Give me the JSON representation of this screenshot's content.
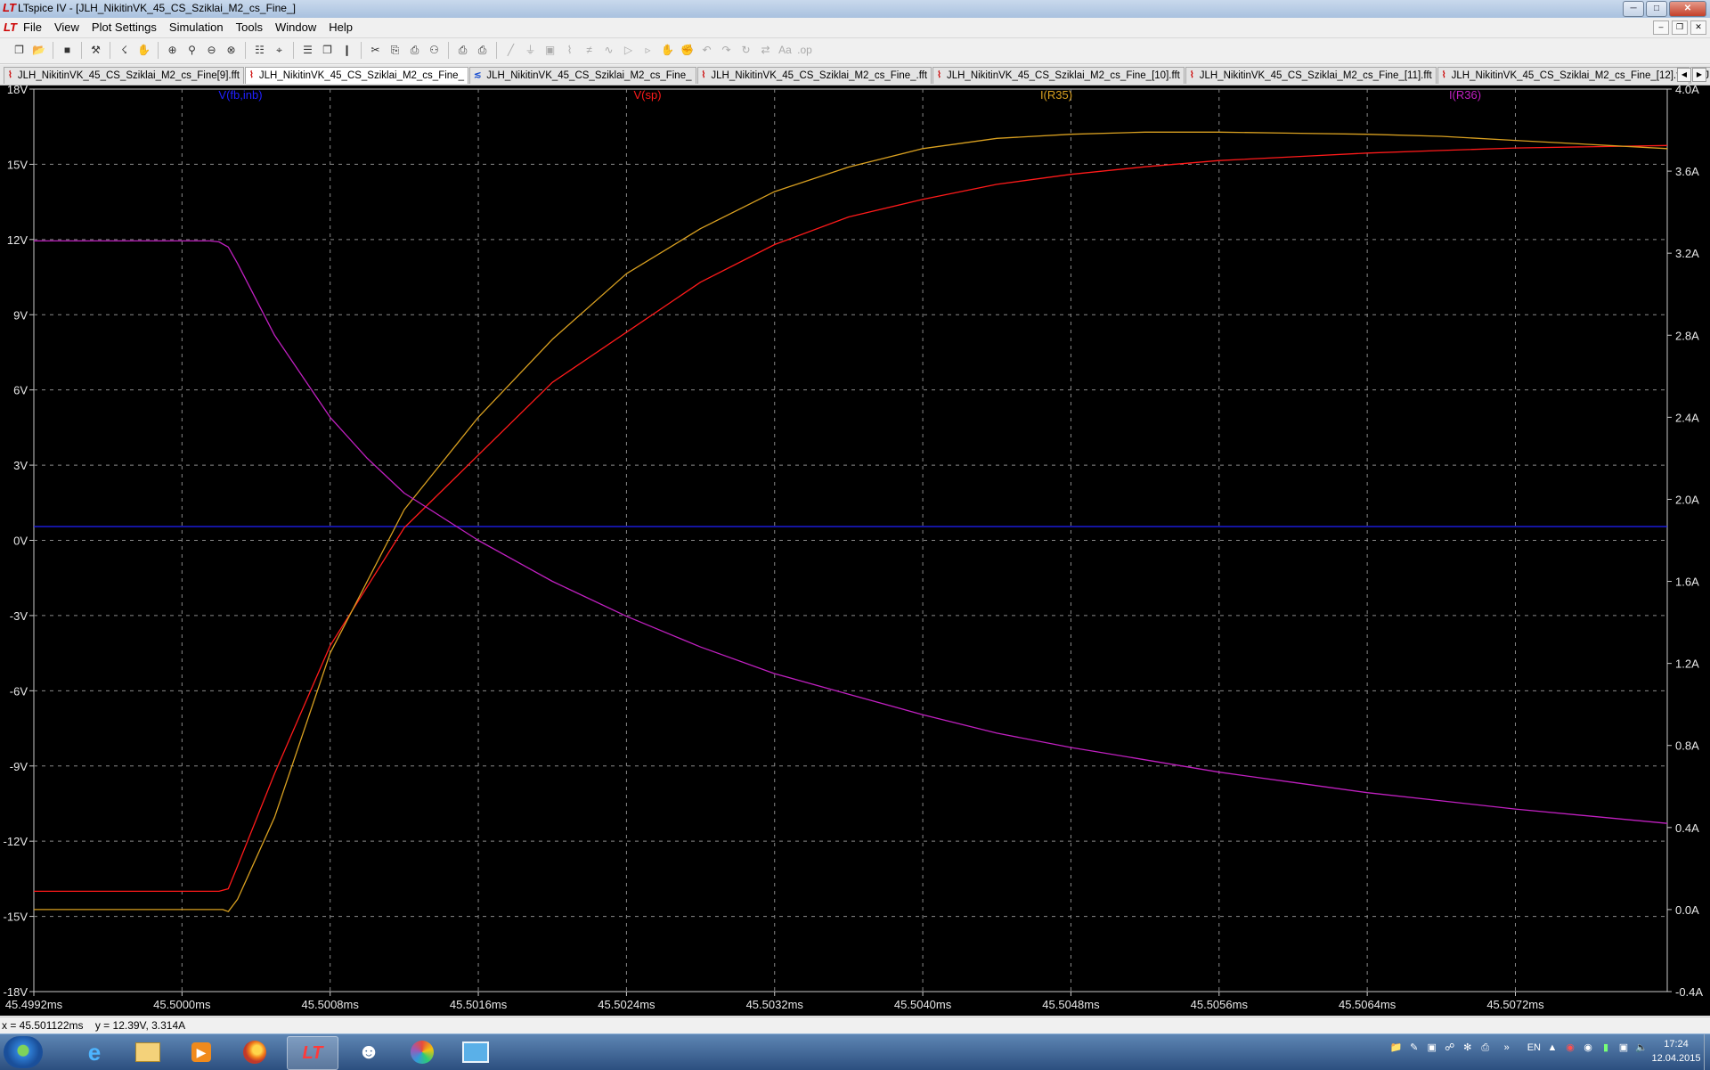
{
  "window": {
    "title": "LTspice IV - [JLH_NikitinVK_45_CS_Sziklai_M2_cs_Fine_]",
    "app_icon": "ltspice-icon",
    "buttons": [
      "minimize-icon",
      "maximize-icon",
      "close-icon"
    ]
  },
  "menubar": {
    "items": [
      "File",
      "View",
      "Plot Settings",
      "Simulation",
      "Tools",
      "Window",
      "Help"
    ]
  },
  "toolbar": {
    "groups": [
      [
        "new-schematic-icon",
        "open-icon"
      ],
      [
        "save-icon"
      ],
      [
        "control-panel-icon"
      ],
      [
        "run-icon",
        "pan-icon"
      ],
      [
        "zoom-in-icon",
        "zoom-area-icon",
        "zoom-out-icon",
        "zoom-cancel-icon"
      ],
      [
        "autorange-icon",
        "mark-icon"
      ],
      [
        "tile-horizontal-icon",
        "cascade-icon",
        "tile-vertical-icon"
      ],
      [
        "cut-icon",
        "copy-icon",
        "paste-icon",
        "find-icon"
      ],
      [
        "print-preview-icon",
        "print-icon"
      ],
      [
        "wire-icon",
        "ground-icon",
        "label-icon",
        "resistor-icon",
        "capacitor-icon",
        "inductor-icon",
        "diode-icon",
        "component-icon",
        "move-icon",
        "drag-icon",
        "undo-icon",
        "redo-icon",
        "rotate-icon",
        "mirror-icon",
        "text-icon",
        "spice-directive-icon"
      ]
    ]
  },
  "tabs": [
    {
      "label": "JLH_NikitinVK_45_CS_Sziklai_M2_cs_Fine[9].fft",
      "icon": "waveform-icon",
      "active": false
    },
    {
      "label": "JLH_NikitinVK_45_CS_Sziklai_M2_cs_Fine_",
      "icon": "waveform-icon",
      "active": true
    },
    {
      "label": "JLH_NikitinVK_45_CS_Sziklai_M2_cs_Fine_",
      "icon": "schematic-icon",
      "active": false
    },
    {
      "label": "JLH_NikitinVK_45_CS_Sziklai_M2_cs_Fine_.fft",
      "icon": "waveform-icon",
      "active": false
    },
    {
      "label": "JLH_NikitinVK_45_CS_Sziklai_M2_cs_Fine_[10].fft",
      "icon": "waveform-icon",
      "active": false
    },
    {
      "label": "JLH_NikitinVK_45_CS_Sziklai_M2_cs_Fine_[11].fft",
      "icon": "waveform-icon",
      "active": false
    },
    {
      "label": "JLH_NikitinVK_45_CS_Sziklai_M2_cs_Fine_[12].fft",
      "icon": "waveform-icon",
      "active": false
    },
    {
      "label": "JL",
      "icon": "waveform-icon",
      "active": false
    }
  ],
  "chart_data": {
    "type": "line",
    "background": "#000000",
    "grid": true,
    "legend_placement": "top",
    "x_ticks": [
      "45.4992ms",
      "45.5000ms",
      "45.5008ms",
      "45.5016ms",
      "45.5024ms",
      "45.5032ms",
      "45.5040ms",
      "45.5048ms",
      "45.5056ms",
      "45.5064ms",
      "45.5072ms"
    ],
    "xlim": [
      45.4992,
      45.50802
    ],
    "y_left": {
      "lim": [
        -18,
        18
      ],
      "ticks": [
        "18V",
        "15V",
        "12V",
        "9V",
        "6V",
        "3V",
        "0V",
        "-3V",
        "-6V",
        "-9V",
        "-12V",
        "-15V",
        "-18V"
      ]
    },
    "y_right": {
      "lim": [
        -0.4,
        4.0
      ],
      "ticks": [
        "4.0A",
        "3.6A",
        "3.2A",
        "2.8A",
        "2.4A",
        "2.0A",
        "1.6A",
        "1.2A",
        "0.8A",
        "0.4A",
        "0.0A",
        "-0.4A"
      ]
    },
    "series": [
      {
        "name": "V(fb,inb)",
        "color": "#2020ff",
        "axis": "left",
        "x": [
          45.4992,
          45.50802
        ],
        "y": [
          0.55,
          0.55
        ]
      },
      {
        "name": "V(sp)",
        "color": "#ff1a1a",
        "axis": "left",
        "x": [
          45.4992,
          45.5002,
          45.50025,
          45.5003,
          45.5005,
          45.5008,
          45.5012,
          45.5016,
          45.502,
          45.5024,
          45.5028,
          45.5032,
          45.5036,
          45.504,
          45.5044,
          45.5048,
          45.5052,
          45.5056,
          45.506,
          45.5064,
          45.5068,
          45.5072,
          45.50802
        ],
        "y": [
          -14.0,
          -14.0,
          -13.9,
          -13.0,
          -9.3,
          -4.2,
          0.5,
          3.4,
          6.3,
          8.3,
          10.3,
          11.8,
          12.9,
          13.6,
          14.2,
          14.6,
          14.9,
          15.15,
          15.3,
          15.45,
          15.55,
          15.65,
          15.75
        ]
      },
      {
        "name": "I(R35)",
        "color": "#d9a020",
        "axis": "right",
        "x": [
          45.4992,
          45.50022,
          45.50025,
          45.5003,
          45.5005,
          45.5008,
          45.5012,
          45.5016,
          45.502,
          45.5024,
          45.5028,
          45.5032,
          45.5036,
          45.504,
          45.5044,
          45.5048,
          45.5052,
          45.5056,
          45.506,
          45.5064,
          45.5068,
          45.5072,
          45.50802
        ],
        "y": [
          0.0,
          0.0,
          -0.01,
          0.05,
          0.45,
          1.25,
          1.95,
          2.4,
          2.78,
          3.1,
          3.32,
          3.5,
          3.62,
          3.71,
          3.76,
          3.78,
          3.79,
          3.79,
          3.785,
          3.78,
          3.77,
          3.75,
          3.71
        ]
      },
      {
        "name": "I(R36)",
        "color": "#c020c0",
        "axis": "right",
        "x": [
          45.4992,
          45.50015,
          45.5002,
          45.50025,
          45.5003,
          45.5005,
          45.5008,
          45.501,
          45.5012,
          45.5016,
          45.502,
          45.5024,
          45.5028,
          45.5032,
          45.5036,
          45.504,
          45.5044,
          45.5048,
          45.5052,
          45.5056,
          45.506,
          45.5064,
          45.5068,
          45.5072,
          45.50802
        ],
        "y": [
          3.26,
          3.26,
          3.255,
          3.23,
          3.15,
          2.8,
          2.4,
          2.2,
          2.03,
          1.8,
          1.6,
          1.43,
          1.28,
          1.15,
          1.05,
          0.95,
          0.86,
          0.79,
          0.73,
          0.67,
          0.62,
          0.57,
          0.53,
          0.49,
          0.42
        ]
      }
    ]
  },
  "status": {
    "readout": "x = 45.501122ms    y = 12.39V, 3.314A"
  },
  "taskbar": {
    "start_icon": "windows-start-icon",
    "apps": [
      "internet-explorer-icon",
      "file-explorer-icon",
      "media-player-icon",
      "firefox-icon",
      "ltspice-icon",
      "alien-app-icon",
      "paint-icon",
      "window-app-icon"
    ],
    "active_index": 4,
    "tray_icons": [
      "folder-icon",
      "note-icon",
      "monitor-icon",
      "network-icon",
      "bluetooth-icon",
      "printer-icon"
    ],
    "language": "EN",
    "tray_status_icons": [
      "up-arrow-icon",
      "antivirus-icon",
      "network-status-icon",
      "battery-icon",
      "display-icon",
      "volume-icon"
    ],
    "time": "17:24",
    "date": "12.04.2015"
  }
}
